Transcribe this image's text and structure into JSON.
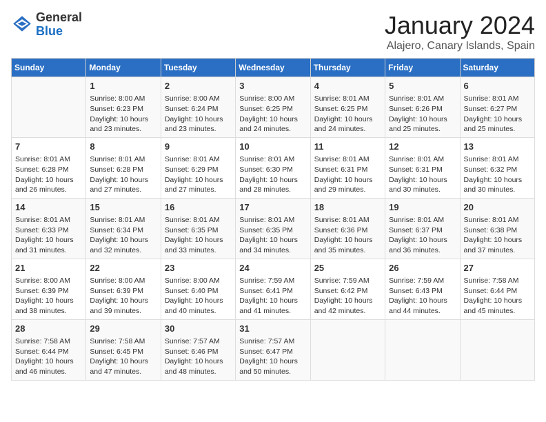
{
  "header": {
    "logo": {
      "general": "General",
      "blue": "Blue"
    },
    "title": "January 2024",
    "location": "Alajero, Canary Islands, Spain"
  },
  "columns": [
    "Sunday",
    "Monday",
    "Tuesday",
    "Wednesday",
    "Thursday",
    "Friday",
    "Saturday"
  ],
  "weeks": [
    [
      {
        "num": "",
        "info": ""
      },
      {
        "num": "1",
        "info": "Sunrise: 8:00 AM\nSunset: 6:23 PM\nDaylight: 10 hours\nand 23 minutes."
      },
      {
        "num": "2",
        "info": "Sunrise: 8:00 AM\nSunset: 6:24 PM\nDaylight: 10 hours\nand 23 minutes."
      },
      {
        "num": "3",
        "info": "Sunrise: 8:00 AM\nSunset: 6:25 PM\nDaylight: 10 hours\nand 24 minutes."
      },
      {
        "num": "4",
        "info": "Sunrise: 8:01 AM\nSunset: 6:25 PM\nDaylight: 10 hours\nand 24 minutes."
      },
      {
        "num": "5",
        "info": "Sunrise: 8:01 AM\nSunset: 6:26 PM\nDaylight: 10 hours\nand 25 minutes."
      },
      {
        "num": "6",
        "info": "Sunrise: 8:01 AM\nSunset: 6:27 PM\nDaylight: 10 hours\nand 25 minutes."
      }
    ],
    [
      {
        "num": "7",
        "info": "Sunrise: 8:01 AM\nSunset: 6:28 PM\nDaylight: 10 hours\nand 26 minutes."
      },
      {
        "num": "8",
        "info": "Sunrise: 8:01 AM\nSunset: 6:28 PM\nDaylight: 10 hours\nand 27 minutes."
      },
      {
        "num": "9",
        "info": "Sunrise: 8:01 AM\nSunset: 6:29 PM\nDaylight: 10 hours\nand 27 minutes."
      },
      {
        "num": "10",
        "info": "Sunrise: 8:01 AM\nSunset: 6:30 PM\nDaylight: 10 hours\nand 28 minutes."
      },
      {
        "num": "11",
        "info": "Sunrise: 8:01 AM\nSunset: 6:31 PM\nDaylight: 10 hours\nand 29 minutes."
      },
      {
        "num": "12",
        "info": "Sunrise: 8:01 AM\nSunset: 6:31 PM\nDaylight: 10 hours\nand 30 minutes."
      },
      {
        "num": "13",
        "info": "Sunrise: 8:01 AM\nSunset: 6:32 PM\nDaylight: 10 hours\nand 30 minutes."
      }
    ],
    [
      {
        "num": "14",
        "info": "Sunrise: 8:01 AM\nSunset: 6:33 PM\nDaylight: 10 hours\nand 31 minutes."
      },
      {
        "num": "15",
        "info": "Sunrise: 8:01 AM\nSunset: 6:34 PM\nDaylight: 10 hours\nand 32 minutes."
      },
      {
        "num": "16",
        "info": "Sunrise: 8:01 AM\nSunset: 6:35 PM\nDaylight: 10 hours\nand 33 minutes."
      },
      {
        "num": "17",
        "info": "Sunrise: 8:01 AM\nSunset: 6:35 PM\nDaylight: 10 hours\nand 34 minutes."
      },
      {
        "num": "18",
        "info": "Sunrise: 8:01 AM\nSunset: 6:36 PM\nDaylight: 10 hours\nand 35 minutes."
      },
      {
        "num": "19",
        "info": "Sunrise: 8:01 AM\nSunset: 6:37 PM\nDaylight: 10 hours\nand 36 minutes."
      },
      {
        "num": "20",
        "info": "Sunrise: 8:01 AM\nSunset: 6:38 PM\nDaylight: 10 hours\nand 37 minutes."
      }
    ],
    [
      {
        "num": "21",
        "info": "Sunrise: 8:00 AM\nSunset: 6:39 PM\nDaylight: 10 hours\nand 38 minutes."
      },
      {
        "num": "22",
        "info": "Sunrise: 8:00 AM\nSunset: 6:39 PM\nDaylight: 10 hours\nand 39 minutes."
      },
      {
        "num": "23",
        "info": "Sunrise: 8:00 AM\nSunset: 6:40 PM\nDaylight: 10 hours\nand 40 minutes."
      },
      {
        "num": "24",
        "info": "Sunrise: 7:59 AM\nSunset: 6:41 PM\nDaylight: 10 hours\nand 41 minutes."
      },
      {
        "num": "25",
        "info": "Sunrise: 7:59 AM\nSunset: 6:42 PM\nDaylight: 10 hours\nand 42 minutes."
      },
      {
        "num": "26",
        "info": "Sunrise: 7:59 AM\nSunset: 6:43 PM\nDaylight: 10 hours\nand 44 minutes."
      },
      {
        "num": "27",
        "info": "Sunrise: 7:58 AM\nSunset: 6:44 PM\nDaylight: 10 hours\nand 45 minutes."
      }
    ],
    [
      {
        "num": "28",
        "info": "Sunrise: 7:58 AM\nSunset: 6:44 PM\nDaylight: 10 hours\nand 46 minutes."
      },
      {
        "num": "29",
        "info": "Sunrise: 7:58 AM\nSunset: 6:45 PM\nDaylight: 10 hours\nand 47 minutes."
      },
      {
        "num": "30",
        "info": "Sunrise: 7:57 AM\nSunset: 6:46 PM\nDaylight: 10 hours\nand 48 minutes."
      },
      {
        "num": "31",
        "info": "Sunrise: 7:57 AM\nSunset: 6:47 PM\nDaylight: 10 hours\nand 50 minutes."
      },
      {
        "num": "",
        "info": ""
      },
      {
        "num": "",
        "info": ""
      },
      {
        "num": "",
        "info": ""
      }
    ]
  ]
}
